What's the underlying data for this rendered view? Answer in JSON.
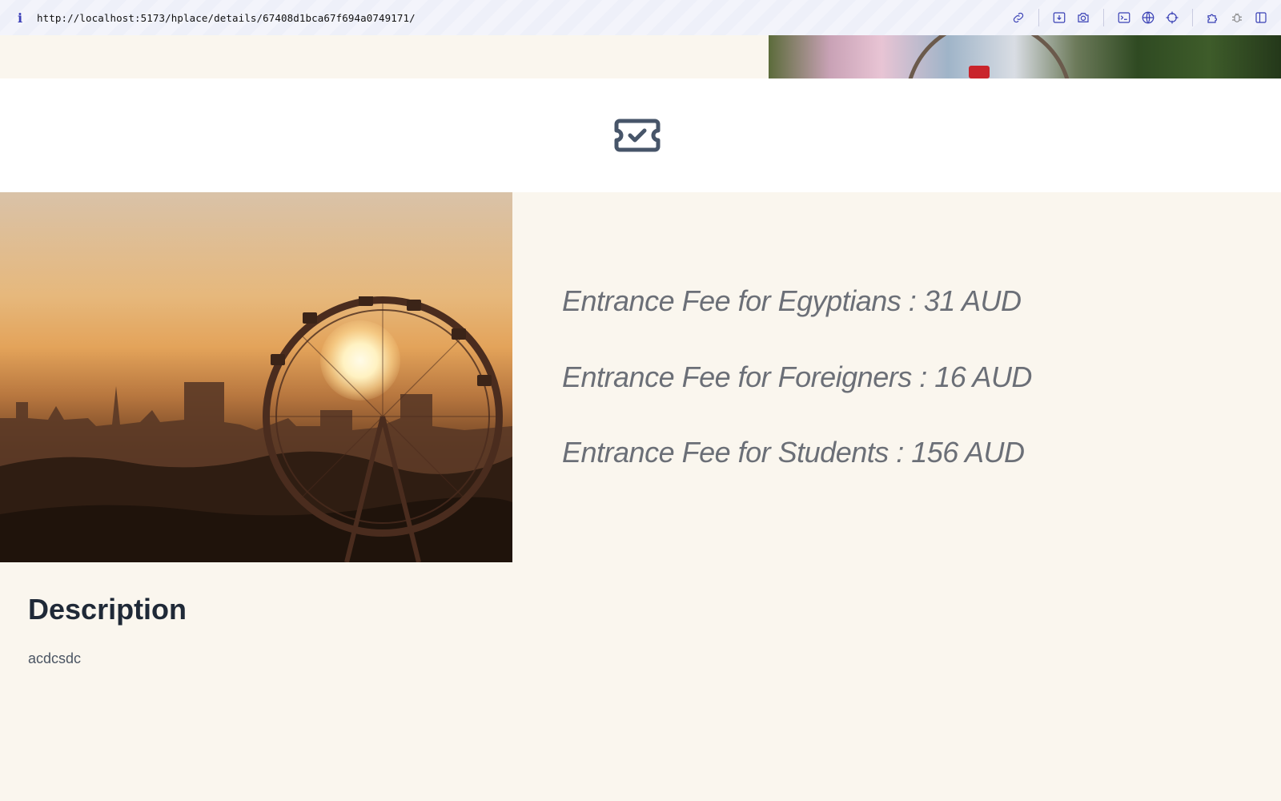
{
  "browser": {
    "info_icon": "info-icon",
    "url": "http://localhost:5173/hplace/details/67408d1bca67f694a0749171/",
    "toolbar_icons": [
      "link-icon",
      "download-icon",
      "camera-icon",
      "terminal-icon",
      "globe-icon",
      "crosshair-icon",
      "puzzle-icon",
      "bug-icon",
      "split-view-icon"
    ]
  },
  "ticket": {
    "icon": "ticket-check-icon"
  },
  "fees": [
    {
      "text": "Entrance Fee for Egyptians : 31 AUD"
    },
    {
      "text": "Entrance Fee for Foreigners : 16 AUD"
    },
    {
      "text": "Entrance Fee for Students : 156 AUD"
    }
  ],
  "description": {
    "heading": "Description",
    "text": "acdcsdc"
  },
  "colors": {
    "page_bg": "#faf6ee",
    "band_bg": "#ffffff",
    "fee_text": "#6b6f77",
    "heading": "#1f2937",
    "toolbar_icon": "#3940b5"
  }
}
